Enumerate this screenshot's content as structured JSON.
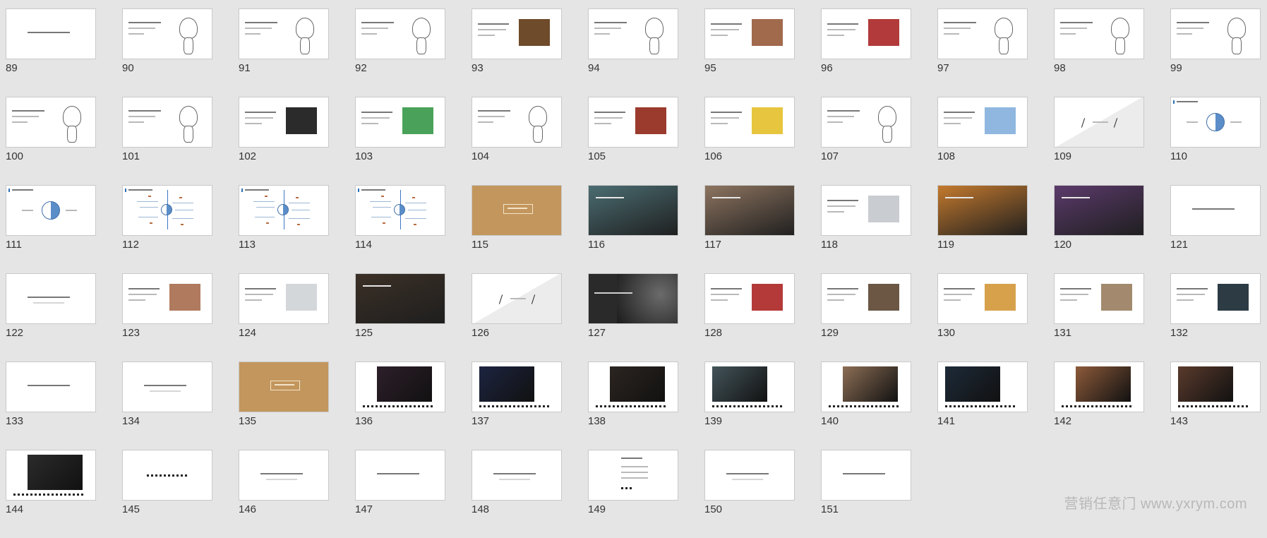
{
  "slides": [
    {
      "num": "89",
      "kind": "text-one"
    },
    {
      "num": "90",
      "kind": "text-fig"
    },
    {
      "num": "91",
      "kind": "text-fig"
    },
    {
      "num": "92",
      "kind": "text-fig"
    },
    {
      "num": "93",
      "kind": "text-photo",
      "color": "#6e4b2a"
    },
    {
      "num": "94",
      "kind": "text-fig"
    },
    {
      "num": "95",
      "kind": "text-photo",
      "color": "#a16a4c"
    },
    {
      "num": "96",
      "kind": "text-photo",
      "color": "#b23a3a"
    },
    {
      "num": "97",
      "kind": "text-fig"
    },
    {
      "num": "98",
      "kind": "text-fig"
    },
    {
      "num": "99",
      "kind": "text-fig"
    },
    {
      "num": "100",
      "kind": "text-fig"
    },
    {
      "num": "101",
      "kind": "text-fig"
    },
    {
      "num": "102",
      "kind": "text-photo",
      "color": "#2b2b2b"
    },
    {
      "num": "103",
      "kind": "text-photo",
      "color": "#4aa25a"
    },
    {
      "num": "104",
      "kind": "text-fig"
    },
    {
      "num": "105",
      "kind": "text-photo",
      "color": "#9a3b2e"
    },
    {
      "num": "106",
      "kind": "text-photo",
      "color": "#e7c53f"
    },
    {
      "num": "107",
      "kind": "text-fig"
    },
    {
      "num": "108",
      "kind": "text-photo",
      "color": "#8fb7df"
    },
    {
      "num": "109",
      "kind": "diag"
    },
    {
      "num": "110",
      "kind": "circle"
    },
    {
      "num": "111",
      "kind": "circle"
    },
    {
      "num": "112",
      "kind": "spider"
    },
    {
      "num": "113",
      "kind": "spider"
    },
    {
      "num": "114",
      "kind": "spider"
    },
    {
      "num": "115",
      "kind": "tan"
    },
    {
      "num": "116",
      "kind": "full",
      "color": "#4b6d72"
    },
    {
      "num": "117",
      "kind": "full",
      "color": "#8d7460"
    },
    {
      "num": "118",
      "kind": "text-photo",
      "color": "#c9ccd1"
    },
    {
      "num": "119",
      "kind": "full",
      "color": "#c47a2e"
    },
    {
      "num": "120",
      "kind": "full",
      "color": "#5b3a6b"
    },
    {
      "num": "121",
      "kind": "text-one"
    },
    {
      "num": "122",
      "kind": "text-one"
    },
    {
      "num": "123",
      "kind": "text-photo",
      "color": "#b07a5f"
    },
    {
      "num": "124",
      "kind": "text-photo",
      "color": "#d4d7da"
    },
    {
      "num": "125",
      "kind": "full",
      "color": "#3b3026"
    },
    {
      "num": "126",
      "kind": "diag"
    },
    {
      "num": "127",
      "kind": "dark"
    },
    {
      "num": "128",
      "kind": "text-photo",
      "color": "#b43a3a"
    },
    {
      "num": "129",
      "kind": "text-photo",
      "color": "#6b5744"
    },
    {
      "num": "130",
      "kind": "text-photo",
      "color": "#d7a14c"
    },
    {
      "num": "131",
      "kind": "text-photo",
      "color": "#a38a6e"
    },
    {
      "num": "132",
      "kind": "text-photo",
      "color": "#2c3b44"
    },
    {
      "num": "133",
      "kind": "text-one"
    },
    {
      "num": "134",
      "kind": "text-one"
    },
    {
      "num": "135",
      "kind": "tan"
    },
    {
      "num": "136",
      "kind": "photo-dashes",
      "color": "#2d1f2a"
    },
    {
      "num": "137",
      "kind": "photo-dashes",
      "color": "#1c2440"
    },
    {
      "num": "138",
      "kind": "photo-dashes",
      "color": "#2c2520"
    },
    {
      "num": "139",
      "kind": "photo-dashes",
      "color": "#43545a"
    },
    {
      "num": "140",
      "kind": "photo-dashes",
      "color": "#8c6e55"
    },
    {
      "num": "141",
      "kind": "photo-dashes",
      "color": "#1d2a38"
    },
    {
      "num": "142",
      "kind": "photo-dashes",
      "color": "#8d5a3a"
    },
    {
      "num": "143",
      "kind": "photo-dashes",
      "color": "#5a3a2c"
    },
    {
      "num": "144",
      "kind": "photo-dashes",
      "color": "#2b2b2b"
    },
    {
      "num": "145",
      "kind": "dashes-only"
    },
    {
      "num": "146",
      "kind": "text-one"
    },
    {
      "num": "147",
      "kind": "text-one"
    },
    {
      "num": "148",
      "kind": "text-one"
    },
    {
      "num": "149",
      "kind": "list"
    },
    {
      "num": "150",
      "kind": "text-one"
    },
    {
      "num": "151",
      "kind": "text-one"
    }
  ],
  "watermark": "营销任意门 www.yxrym.com"
}
